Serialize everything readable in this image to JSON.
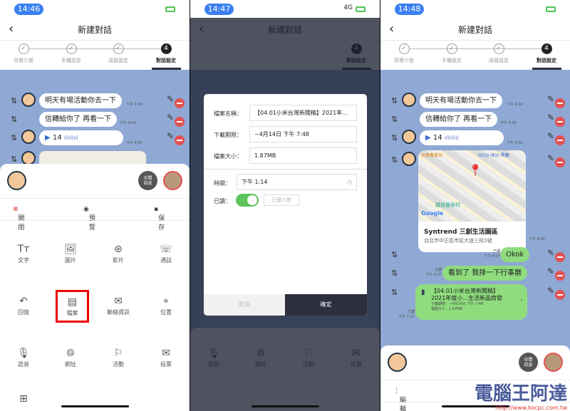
{
  "screens": [
    {
      "time": "14:46"
    },
    {
      "time": "14:47",
      "signal": "4G"
    },
    {
      "time": "14:48"
    }
  ],
  "header": {
    "title": "新建對話"
  },
  "steps": [
    "背景介面",
    "手機設定",
    "成員設定",
    "對話設定"
  ],
  "active_step": "4",
  "messages": {
    "m1": {
      "text": "明天有場活動你去一下",
      "time": "下午 4:04"
    },
    "m2": {
      "text": "信轉給你了 再看一下",
      "time": "下午 4:04"
    },
    "m3": {
      "text": "14",
      "time": "下午 4:05"
    },
    "map": {
      "name": "Syntrend 三創生活園區",
      "address": "台北市中正區市民大道三段2號",
      "time": "下午 4:06",
      "labels": [
        "鐵道藝術村",
        "Google",
        "GO沙-冰沙-黑糖",
        "台東農會站"
      ]
    },
    "m5": {
      "text": "Okok",
      "read": "已讀",
      "time": "下午 4:07"
    },
    "m6": {
      "text": "看到了 我排一下行事曆",
      "read": "已讀",
      "time": "下午 4:07"
    },
    "file": {
      "title1": "【04.01小米台灣新聞稿】",
      "title2": "2021年度小...生活新品齊發",
      "expiry": "下載期限：~4月14日 下午 7:48",
      "size": "檔案大小：1.87MB",
      "read": "已讀",
      "time": "下午 1:14"
    }
  },
  "sheet": {
    "middle_label_1": "中間",
    "middle_label_2": "訊息",
    "close": "關閉",
    "preview": "預覽",
    "save": "保存",
    "edit": "編輯"
  },
  "grid": [
    "文字",
    "圖片",
    "影片",
    "通話",
    "回復",
    "檔案",
    "聯絡資訊",
    "位置",
    "語音",
    "網址",
    "活動",
    "投票"
  ],
  "highlighted_item": "檔案",
  "modal": {
    "name_label": "檔案名稱：",
    "name_value": "【04.01小米台灣新聞稿】2021年...",
    "expiry_label": "下載期限：",
    "expiry_value": "~4月14日 下午 7:48",
    "size_label": "檔案大小：",
    "size_value": "1.87MB",
    "time_label": "時間：",
    "time_value": "下午 1:14",
    "read_label": "已讀：",
    "read_toggle": true,
    "read_count_placeholder": "已讀人數",
    "cancel": "取消",
    "confirm": "確定"
  },
  "watermark": {
    "text": "電腦王阿達",
    "url": "http://www.kocpc.com.tw"
  },
  "colors": {
    "accent": "#3a7ff0",
    "chat_bg": "#8fa8d4",
    "bubble_green": "#8fdc7e",
    "delete": "#e35252",
    "highlight": "#e00000",
    "dark": "#2b2f3e"
  }
}
